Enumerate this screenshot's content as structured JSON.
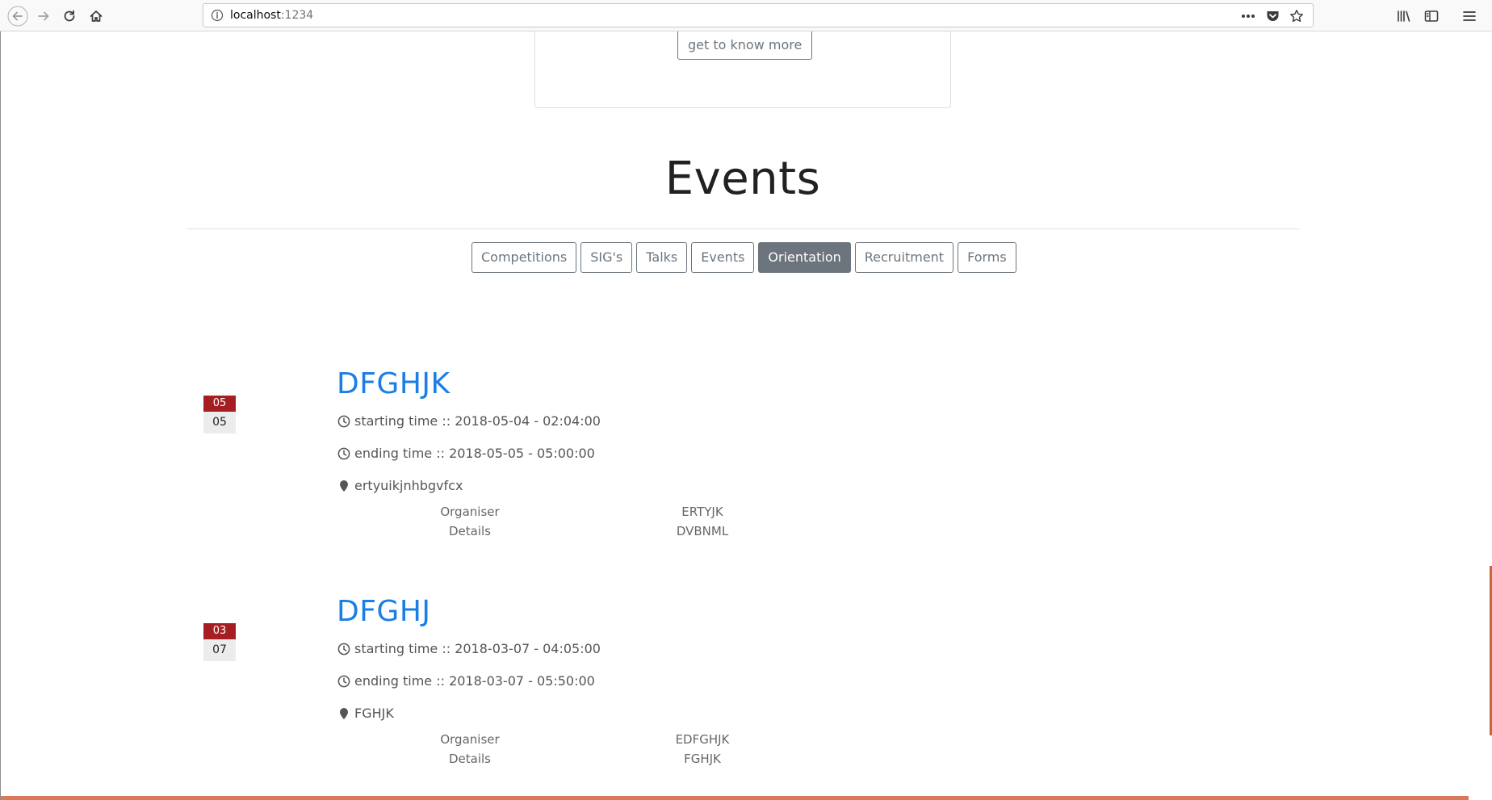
{
  "browser": {
    "url_host": "localhost",
    "url_port": ":1234"
  },
  "hero": {
    "know_more_label": "get to know more"
  },
  "events_section": {
    "title": "Events",
    "tabs": [
      {
        "label": "Competitions",
        "active": false
      },
      {
        "label": "SIG's",
        "active": false
      },
      {
        "label": "Talks",
        "active": false
      },
      {
        "label": "Events",
        "active": false
      },
      {
        "label": "Orientation",
        "active": true
      },
      {
        "label": "Recruitment",
        "active": false
      },
      {
        "label": "Forms",
        "active": false
      }
    ],
    "items": [
      {
        "month": "05",
        "day": "05",
        "title": "DFGHJK",
        "start": "starting time :: 2018-05-04 - 02:04:00",
        "end": "ending time :: 2018-05-05 - 05:00:00",
        "location": "ertyuikjnhbgvfcx",
        "labels": [
          "Organiser",
          "Details"
        ],
        "values": [
          "ERTYJK",
          "DVBNML"
        ]
      },
      {
        "month": "03",
        "day": "07",
        "title": "DFGHJ",
        "start": "starting time :: 2018-03-07 - 04:05:00",
        "end": "ending time :: 2018-03-07 - 05:50:00",
        "location": "FGHJK",
        "labels": [
          "Organiser",
          "Details"
        ],
        "values": [
          "EDFGHJK",
          "FGHJK"
        ]
      }
    ]
  },
  "colors": {
    "accent": "#1a7ee6",
    "badge_month": "#a51e22",
    "active_tab": "#6c757d",
    "bottom_bar": "#d9795c"
  }
}
